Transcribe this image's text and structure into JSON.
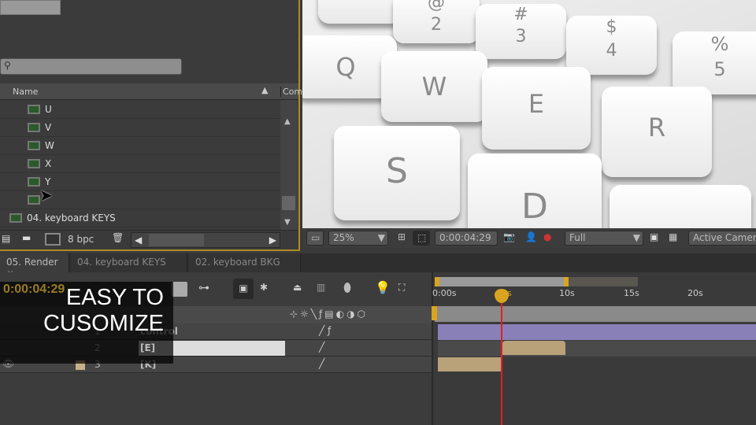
{
  "project": {
    "column_name": "Name",
    "column_comment": "Com",
    "items": [
      "U",
      "V",
      "W",
      "X",
      "Y",
      ""
    ],
    "comp_item": "04. keyboard KEYS",
    "bpc": "8 bpc"
  },
  "viewer": {
    "keys": [
      {
        "top": "@",
        "bottom": "2"
      },
      {
        "top": "#",
        "bottom": "3"
      },
      {
        "top": "$",
        "bottom": "4"
      },
      {
        "top": "%",
        "bottom": "5"
      },
      "Q",
      "W",
      "E",
      "R",
      "S",
      "D"
    ],
    "zoom": "25%",
    "timecode": "0:00:04:29",
    "resolution": "Full",
    "camera": "Active Camera"
  },
  "tabs": [
    {
      "label": "05. Render",
      "close": "×"
    },
    {
      "label": "04. keyboard KEYS"
    },
    {
      "label": "02. keyboard BKG"
    }
  ],
  "timeline": {
    "current_time": "0:00:04:29",
    "ruler": [
      "0:00s",
      "05s",
      "10s",
      "15s",
      "20s"
    ],
    "layers": [
      {
        "num": "1",
        "name": "control"
      },
      {
        "num": "2",
        "name": "[E]"
      },
      {
        "num": "3",
        "name": "[K]"
      }
    ],
    "accent": "#d9a520",
    "playhead_color": "#e02020",
    "layer1_bar": "#8a80b8",
    "clip_color": "#b9a27a"
  },
  "overlay": {
    "line1": "EASY TO",
    "line2": "CUSOMIZE"
  }
}
